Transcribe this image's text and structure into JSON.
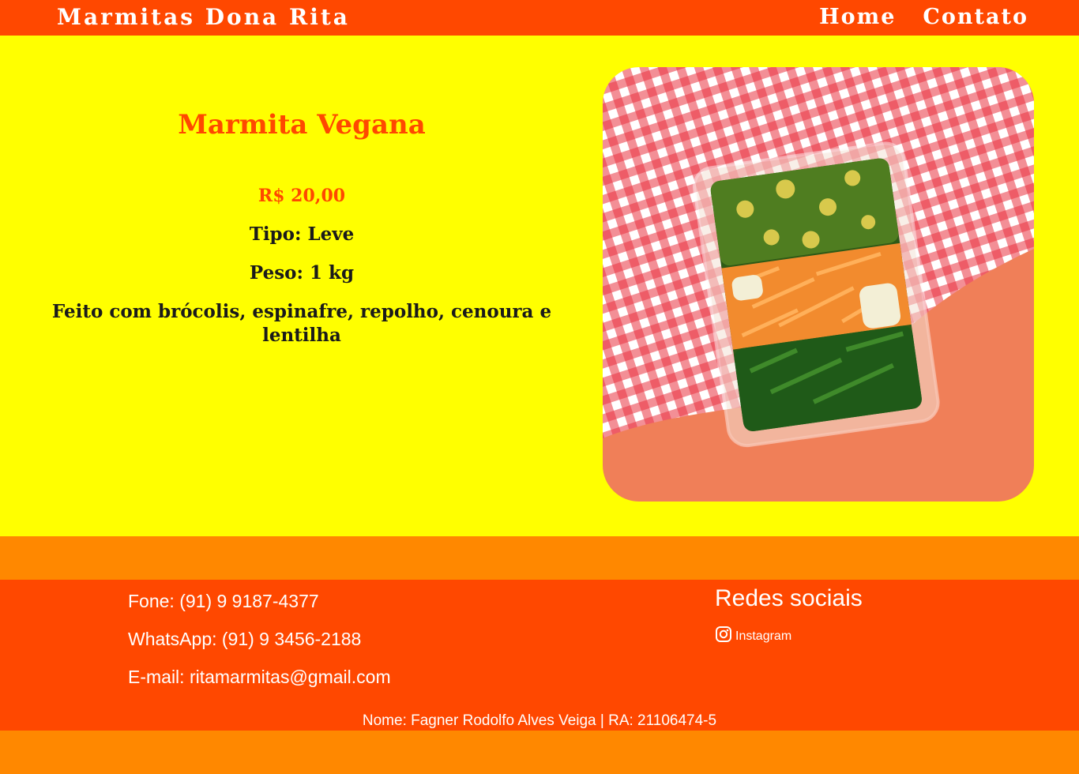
{
  "header": {
    "brand": "Marmitas Dona Rita",
    "nav": [
      {
        "label": "Home"
      },
      {
        "label": "Contato"
      }
    ]
  },
  "product": {
    "title": "Marmita Vegana",
    "price": "R$ 20,00",
    "type": "Tipo: Leve",
    "weight": "Peso: 1 kg",
    "description": "Feito com brócolis, espinafre, repolho, cenoura e lentilha"
  },
  "footer": {
    "phone": "Fone: (91) 9 9187-4377",
    "whatsapp": "WhatsApp: (91) 9 3456-2188",
    "email": "E-mail: ritamarmitas@gmail.com",
    "social_title": "Redes sociais",
    "instagram_label": "Instagram",
    "credit": "Nome: Fagner Rodolfo Alves Veiga | RA: 21106474-5"
  },
  "colors": {
    "header_bg": "#ff4800",
    "main_bg": "#ffff00",
    "band_bg": "#ff8800",
    "footer_bg": "#ff4800",
    "accent_text": "#ff4800"
  },
  "icons": {
    "instagram": "instagram-icon"
  }
}
